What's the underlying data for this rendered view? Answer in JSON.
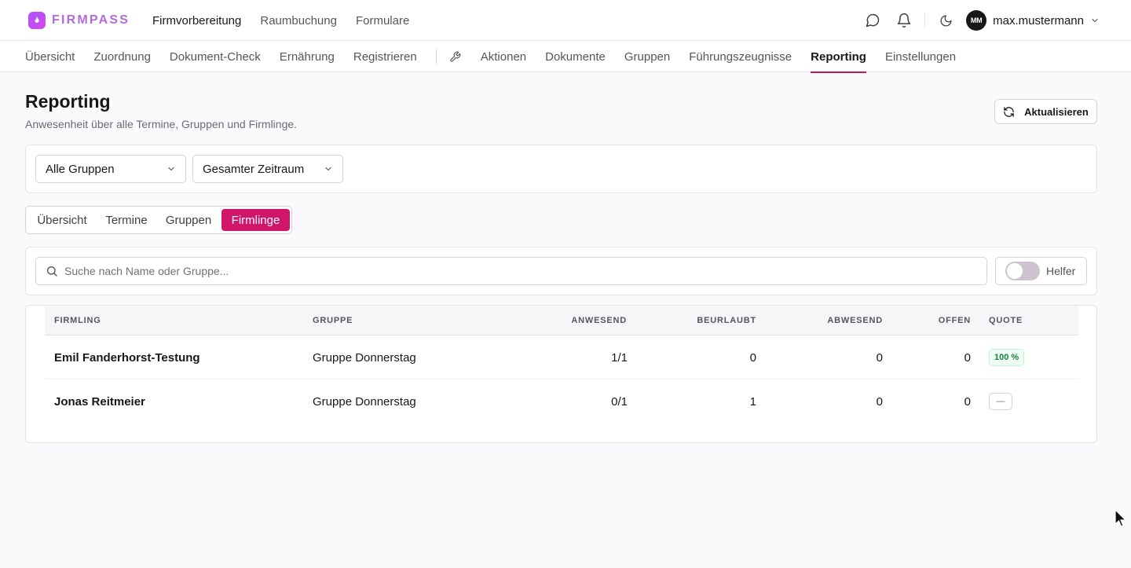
{
  "app": {
    "brand": "FIRMPASS"
  },
  "main_nav": [
    {
      "label": "Firmvorbereitung",
      "active": true
    },
    {
      "label": "Raumbuchung",
      "active": false
    },
    {
      "label": "Formulare",
      "active": false
    }
  ],
  "user": {
    "initials": "MM",
    "name": "max.mustermann"
  },
  "sub_nav": {
    "left": [
      "Übersicht",
      "Zuordnung",
      "Dokument-Check",
      "Ernährung",
      "Registrieren"
    ],
    "right": [
      "Aktionen",
      "Dokumente",
      "Gruppen",
      "Führungszeugnisse",
      "Reporting",
      "Einstellungen"
    ],
    "active": "Reporting"
  },
  "header": {
    "title": "Reporting",
    "subtitle": "Anwesenheit über alle Termine, Gruppen und Firmlinge.",
    "refresh_label": "Aktualisieren"
  },
  "filters": {
    "group": "Alle Gruppen",
    "period": "Gesamter Zeitraum"
  },
  "tabs": [
    {
      "label": "Übersicht",
      "active": false
    },
    {
      "label": "Termine",
      "active": false
    },
    {
      "label": "Gruppen",
      "active": false
    },
    {
      "label": "Firmlinge",
      "active": true
    }
  ],
  "search": {
    "placeholder": "Suche nach Name oder Gruppe...",
    "value": "",
    "helper_label": "Helfer",
    "helper_on": false
  },
  "table": {
    "headers": {
      "name": "Firmling",
      "group": "Gruppe",
      "present": "Anwesend",
      "excused": "Beurlaubt",
      "absent": "Abwesend",
      "open": "Offen",
      "quota": "Quote"
    },
    "rows": [
      {
        "name": "Emil Fanderhorst-Testung",
        "group": "Gruppe Donnerstag",
        "present": "1/1",
        "excused": "0",
        "absent": "0",
        "open": "0",
        "quota": "100 %"
      },
      {
        "name": "Jonas Reitmeier",
        "group": "Gruppe Donnerstag",
        "present": "0/1",
        "excused": "1",
        "absent": "0",
        "open": "0",
        "quota": "—"
      }
    ]
  },
  "colors": {
    "accent": "#d1156a",
    "brand": "#b26ad9",
    "quota_ok": "#15803d"
  }
}
